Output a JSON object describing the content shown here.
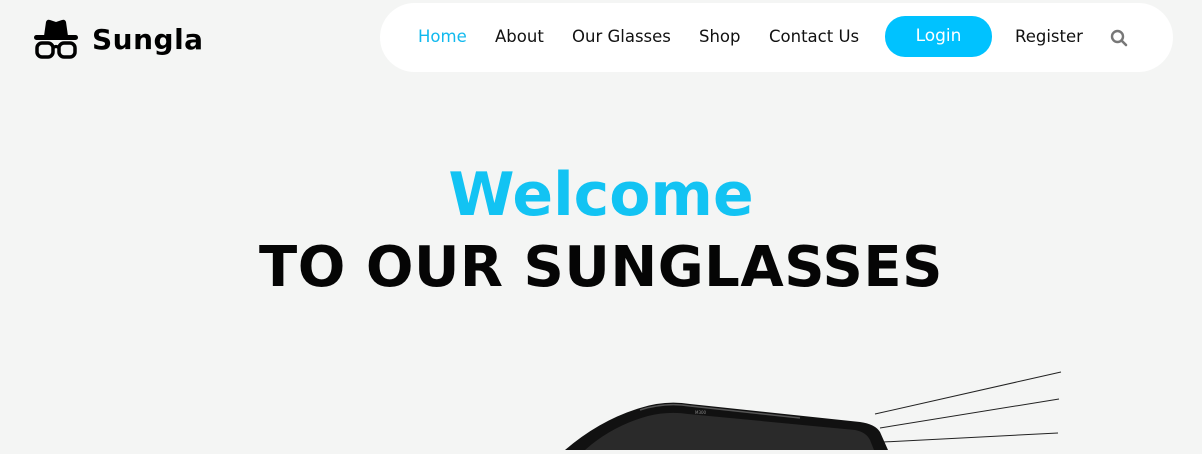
{
  "brand": {
    "name": "Sungla",
    "icon": "hat-glasses-icon"
  },
  "nav": {
    "items": [
      {
        "label": "Home",
        "active": true
      },
      {
        "label": "About",
        "active": false
      },
      {
        "label": "Our Glasses",
        "active": false
      },
      {
        "label": "Shop",
        "active": false
      },
      {
        "label": "Contact Us",
        "active": false
      }
    ],
    "login_label": "Login",
    "register_label": "Register",
    "search_icon": "search-icon"
  },
  "hero": {
    "welcome": "Welcome",
    "subtitle": "TO OUR SUNGLASSES"
  },
  "colors": {
    "accent": "#00c2ff",
    "active_link": "#11b9ee",
    "background": "#f4f5f4",
    "nav_background": "#ffffff",
    "text": "#000000"
  }
}
